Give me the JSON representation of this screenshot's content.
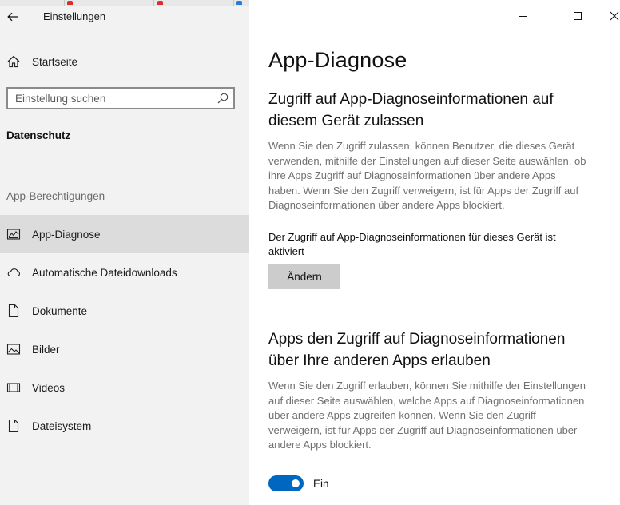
{
  "window": {
    "title": "Einstellungen",
    "controls": {
      "minimize_icon": "minimize-icon",
      "maximize_icon": "maximize-icon",
      "close_icon": "close-icon"
    }
  },
  "sidebar": {
    "home_label": "Startseite",
    "search_placeholder": "Einstellung suchen",
    "category": "Datenschutz",
    "group_label": "App-Berechtigungen",
    "items": [
      {
        "label": "App-Diagnose",
        "icon": "diagnostics-icon",
        "selected": true
      },
      {
        "label": "Automatische Dateidownloads",
        "icon": "cloud-icon",
        "selected": false
      },
      {
        "label": "Dokumente",
        "icon": "document-icon",
        "selected": false
      },
      {
        "label": "Bilder",
        "icon": "picture-icon",
        "selected": false
      },
      {
        "label": "Videos",
        "icon": "film-icon",
        "selected": false
      },
      {
        "label": "Dateisystem",
        "icon": "file-system-icon",
        "selected": false
      }
    ]
  },
  "main": {
    "title": "App-Diagnose",
    "section1": {
      "heading_line1": "Zugriff auf App-Diagnoseinformationen auf",
      "heading_line2": "diesem Gerät zulassen",
      "lines": [
        "Wenn Sie den Zugriff zulassen, können Benutzer, die dieses Gerät",
        "verwenden, mithilfe der Einstellungen auf dieser Seite auswählen, ob",
        "ihre Apps Zugriff auf Diagnoseinformationen über andere Apps",
        "haben. Wenn Sie den Zugriff verweigern, ist für Apps der Zugriff auf",
        "Diagnoseinformationen über andere Apps blockiert."
      ],
      "status_line1": "Der Zugriff auf App-Diagnoseinformationen für dieses Gerät ist",
      "status_line2": "aktiviert",
      "button_label": "Ändern"
    },
    "section2": {
      "heading_line1": "Apps den Zugriff auf Diagnoseinformationen",
      "heading_line2": "über Ihre anderen Apps erlauben",
      "lines": [
        "Wenn Sie den Zugriff erlauben, können Sie mithilfe der Einstellungen",
        "auf dieser Seite auswählen, welche Apps auf Diagnoseinformationen",
        "über andere Apps zugreifen können. Wenn Sie den Zugriff",
        "verweigern, ist für Apps der Zugriff auf Diagnoseinformationen über",
        "andere Apps blockiert."
      ],
      "toggle_state": "on",
      "toggle_label": "Ein"
    }
  },
  "colors": {
    "accent": "#0067c0",
    "sidebar_bg": "#f2f2f2",
    "selected_bg": "#dcdcdc",
    "muted_text": "#707070"
  }
}
